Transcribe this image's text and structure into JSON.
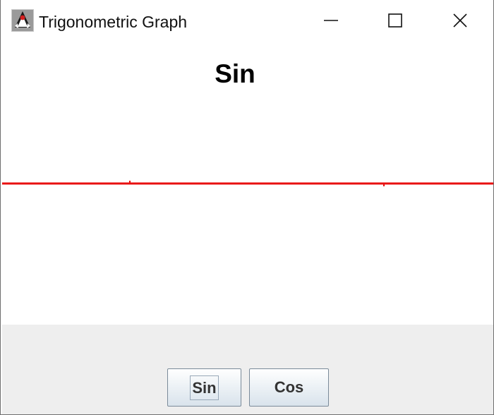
{
  "window": {
    "title": "Trigonometric Graph",
    "icons": {
      "app": "java-duke-icon",
      "minimize": "minimize-icon",
      "maximize": "maximize-icon",
      "close": "close-icon"
    }
  },
  "graph": {
    "title": "Sin",
    "line_color": "#e81010"
  },
  "buttons": {
    "sin_label": "Sin",
    "cos_label": "Cos",
    "focused": "Sin"
  }
}
